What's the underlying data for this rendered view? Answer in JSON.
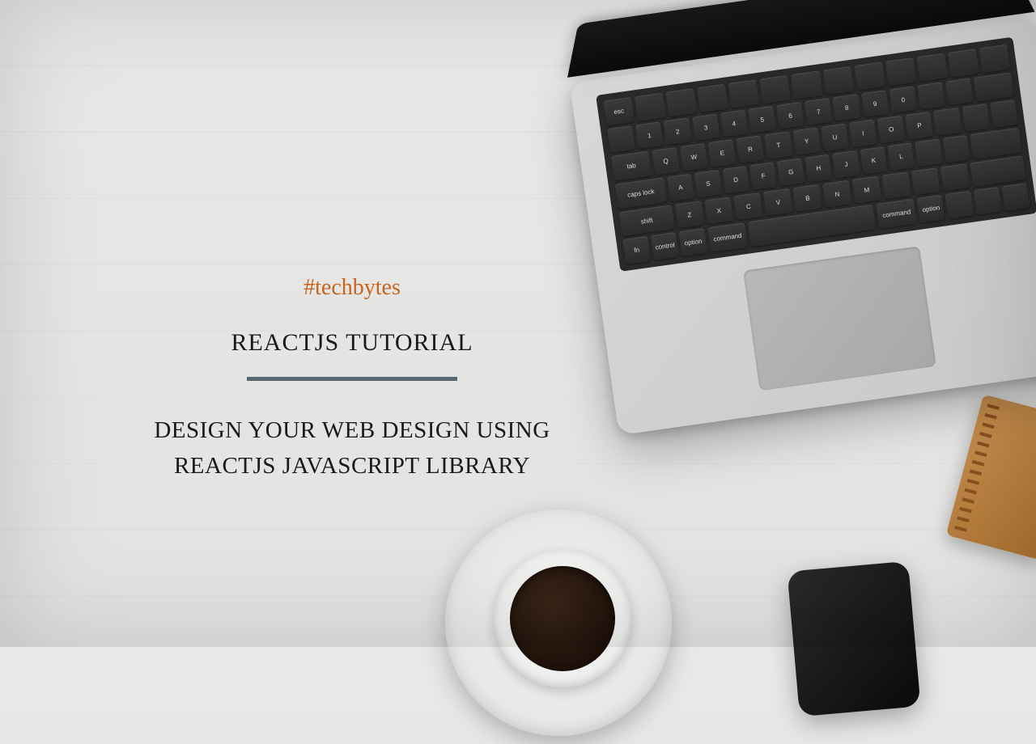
{
  "hashtag": "#techbytes",
  "title": "REACTJS TUTORIAL",
  "subtitle": "DESIGN YOUR WEB DESIGN USING REACTJS JAVASCRIPT LIBRARY",
  "colors": {
    "accent": "#c8641e",
    "text": "#1a1a1a",
    "divider": "#5a6670"
  }
}
